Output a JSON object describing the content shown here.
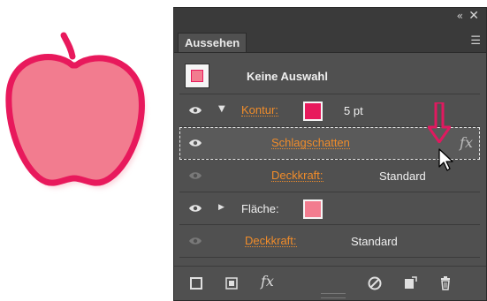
{
  "panel": {
    "tab_label": "Aussehen",
    "collapse_glyph": "«",
    "close_glyph": "✕",
    "menu_glyph": "☰"
  },
  "rows": {
    "header_label": "Keine Auswahl",
    "kontur_label": "Kontur:",
    "kontur_value": "5 pt",
    "schlagschatten_label": "Schlagschatten",
    "deckkraft1_label": "Deckkraft:",
    "deckkraft1_value": "Standard",
    "flaeche_label": "Fläche:",
    "deckkraft2_label": "Deckkraft:",
    "deckkraft2_value": "Standard",
    "fx_label": "fx"
  },
  "footer": {
    "fx_label": "fx"
  },
  "colors": {
    "accent_orange": "#f08c2a",
    "stroke_pink": "#e8195c",
    "fill_pink": "#f27c8f",
    "arrow_pink": "#e0195f"
  },
  "icons": [
    "eye-icon",
    "new-stroke-icon",
    "new-fill-icon",
    "fx-icon",
    "clear-appearance-icon",
    "duplicate-item-icon",
    "delete-icon"
  ]
}
